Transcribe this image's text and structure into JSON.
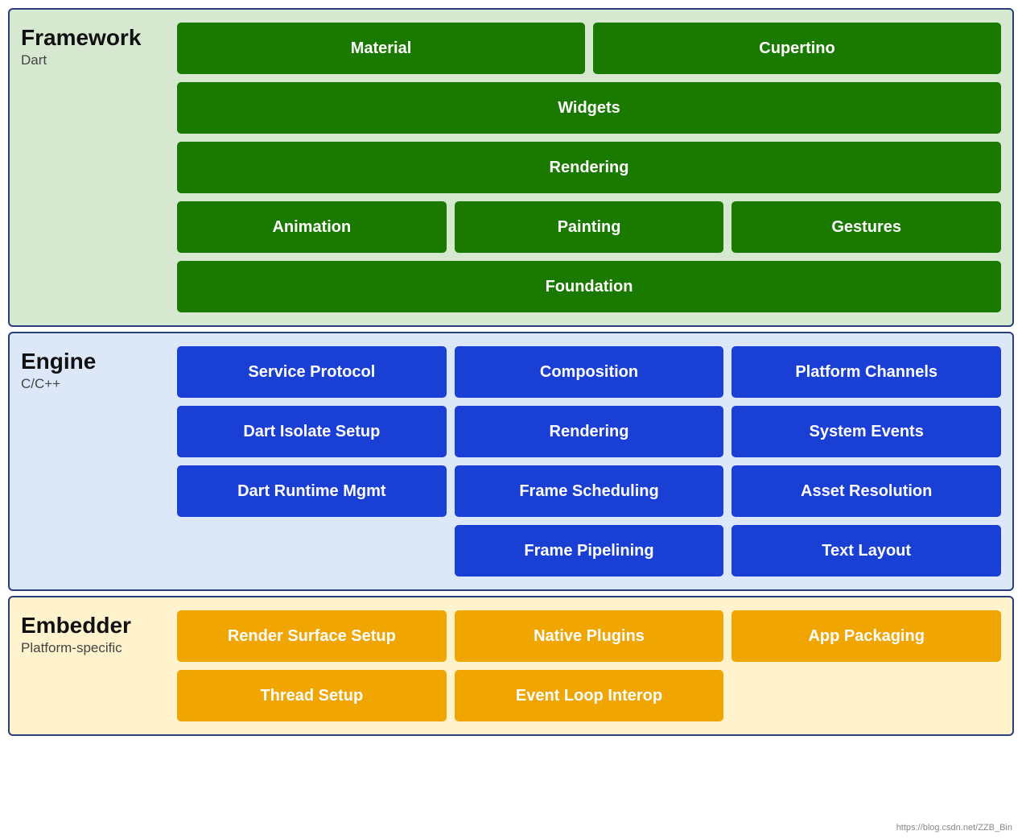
{
  "framework": {
    "title": "Framework",
    "subtitle": "Dart",
    "rows": [
      [
        {
          "label": "Material",
          "span": 1
        },
        {
          "label": "Cupertino",
          "span": 1
        }
      ],
      [
        {
          "label": "Widgets",
          "span": 2
        }
      ],
      [
        {
          "label": "Rendering",
          "span": 2
        }
      ],
      [
        {
          "label": "Animation",
          "span": 1
        },
        {
          "label": "Painting",
          "span": 1
        },
        {
          "label": "Gestures",
          "span": 1
        }
      ],
      [
        {
          "label": "Foundation",
          "span": 2
        }
      ]
    ]
  },
  "engine": {
    "title": "Engine",
    "subtitle": "C/C++",
    "rows": [
      [
        {
          "label": "Service Protocol"
        },
        {
          "label": "Composition"
        },
        {
          "label": "Platform Channels"
        }
      ],
      [
        {
          "label": "Dart Isolate Setup"
        },
        {
          "label": "Rendering"
        },
        {
          "label": "System Events"
        }
      ],
      [
        {
          "label": "Dart Runtime Mgmt"
        },
        {
          "label": "Frame Scheduling"
        },
        {
          "label": "Asset Resolution"
        }
      ],
      [
        {
          "label": "",
          "empty": true
        },
        {
          "label": "Frame Pipelining"
        },
        {
          "label": "Text Layout"
        }
      ]
    ]
  },
  "embedder": {
    "title": "Embedder",
    "subtitle": "Platform-specific",
    "rows": [
      [
        {
          "label": "Render Surface Setup"
        },
        {
          "label": "Native Plugins"
        },
        {
          "label": "App Packaging"
        }
      ],
      [
        {
          "label": "Thread Setup"
        },
        {
          "label": "Event Loop Interop"
        },
        {
          "label": "",
          "empty": true
        }
      ]
    ]
  },
  "watermark": "https://blog.csdn.net/ZZB_Bin"
}
